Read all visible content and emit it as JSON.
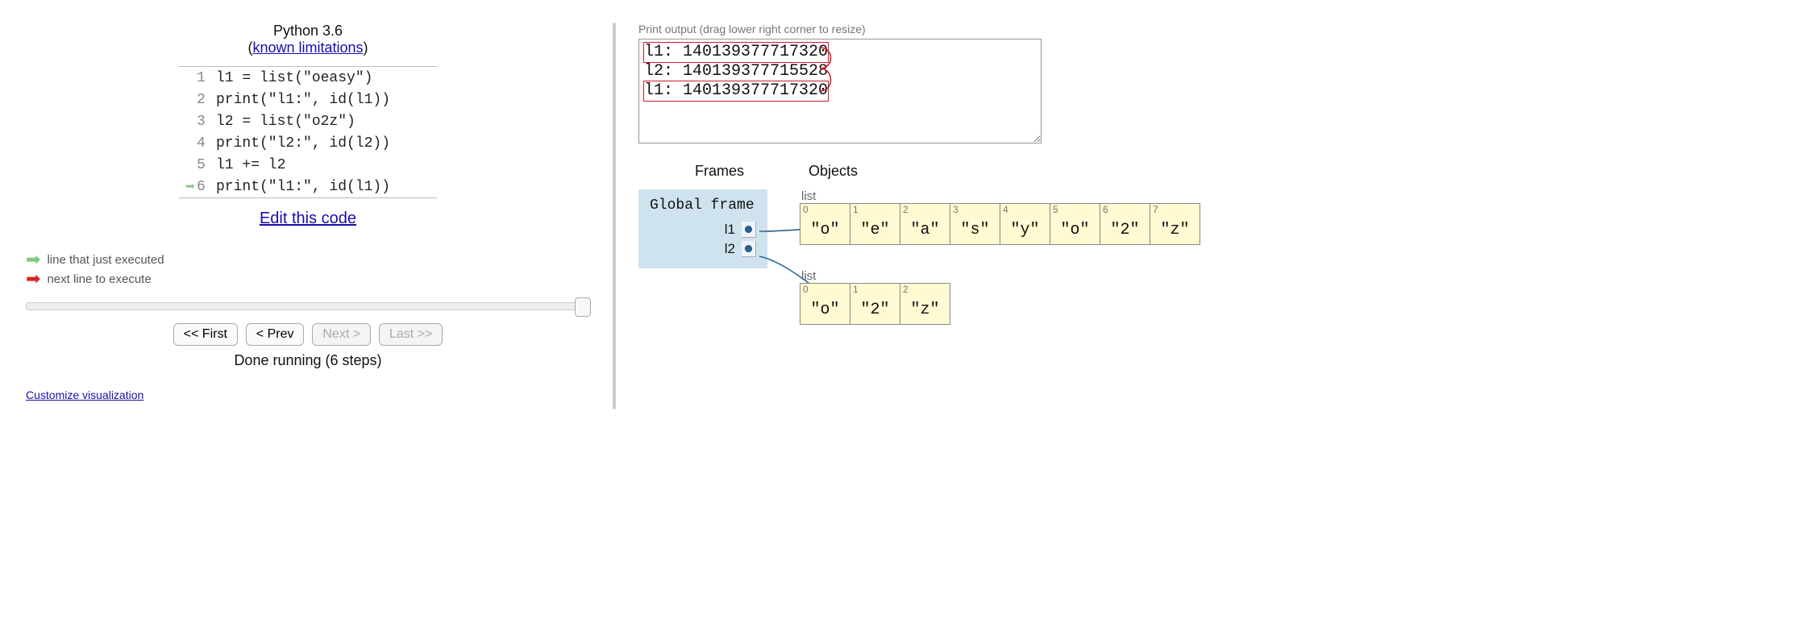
{
  "header": {
    "version": "Python 3.6",
    "limitations_label": "known limitations"
  },
  "code": {
    "lines": [
      {
        "n": "1",
        "text": "l1 = list(\"oeasy\")"
      },
      {
        "n": "2",
        "text": "print(\"l1:\", id(l1))"
      },
      {
        "n": "3",
        "text": "l2 = list(\"o2z\")"
      },
      {
        "n": "4",
        "text": "print(\"l2:\", id(l2))"
      },
      {
        "n": "5",
        "text": "l1 += l2"
      },
      {
        "n": "6",
        "text": "print(\"l1:\", id(l1))"
      }
    ],
    "just_executed_line": 6
  },
  "edit_link": "Edit this code",
  "legend": {
    "just": "line that just executed",
    "next": "next line to execute"
  },
  "nav": {
    "first": "<< First",
    "prev": "< Prev",
    "next": "Next >",
    "last": "Last >>"
  },
  "status": "Done running (6 steps)",
  "customize": "Customize visualization",
  "output": {
    "label": "Print output (drag lower right corner to resize)",
    "lines": [
      "l1: 140139377717320",
      "l2: 140139377715528",
      "l1: 140139377717320"
    ]
  },
  "fo_headers": {
    "frames": "Frames",
    "objects": "Objects"
  },
  "frame": {
    "title": "Global frame",
    "vars": [
      "l1",
      "l2"
    ]
  },
  "objects": [
    {
      "type": "list",
      "items": [
        "\"o\"",
        "\"e\"",
        "\"a\"",
        "\"s\"",
        "\"y\"",
        "\"o\"",
        "\"2\"",
        "\"z\""
      ]
    },
    {
      "type": "list",
      "items": [
        "\"o\"",
        "\"2\"",
        "\"z\""
      ]
    }
  ]
}
